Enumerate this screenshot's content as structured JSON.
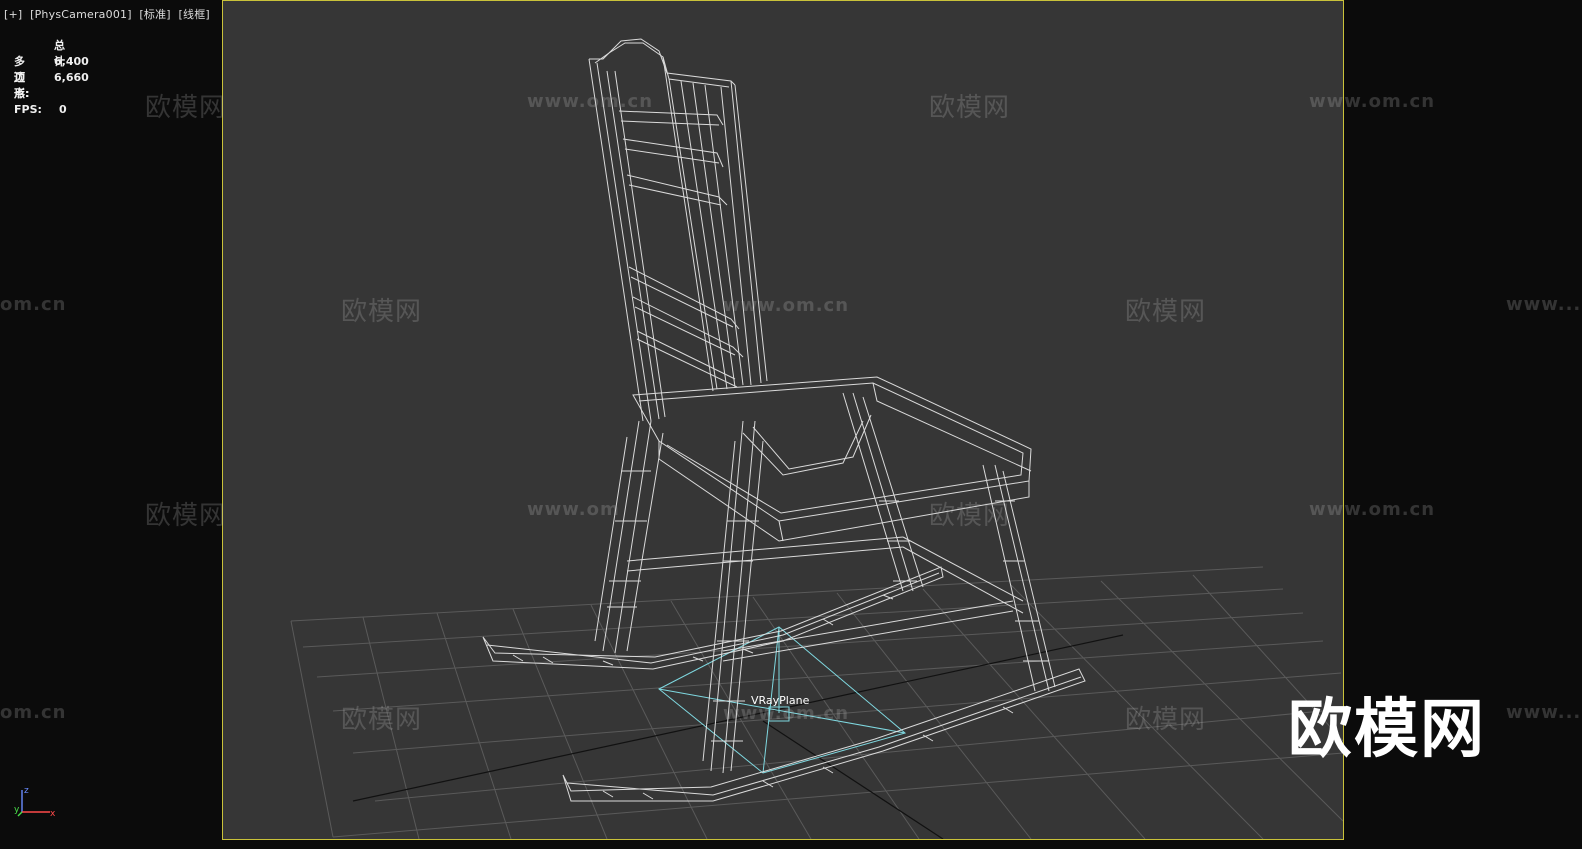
{
  "viewport": {
    "label_plus": "[+]",
    "label_camera": "[PhysCamera001]",
    "label_shading": "[标准]",
    "label_mode": "[线框]"
  },
  "stats": {
    "header": "总计",
    "polygons_label": "多边形:",
    "polygons_value": "6,400",
    "vertices_label": "顶点:",
    "vertices_value": "6,660",
    "fps_label": "FPS:",
    "fps_value": "0"
  },
  "scene": {
    "object_label": "VRayPlane",
    "wire_color": "#e8e8e8",
    "light_color": "#7fd8e0",
    "grid_color": "#5a5a5a",
    "frame_color": "#c9c23a"
  },
  "watermarks": {
    "logo_text": "欧模网",
    "url_text": "www.om.cn",
    "partial_url_left": "om.cn",
    "partial_url_right": "www...",
    "partial_url_mid": "www.om"
  },
  "axis": {
    "z": "z",
    "x": "x",
    "y": "y"
  }
}
